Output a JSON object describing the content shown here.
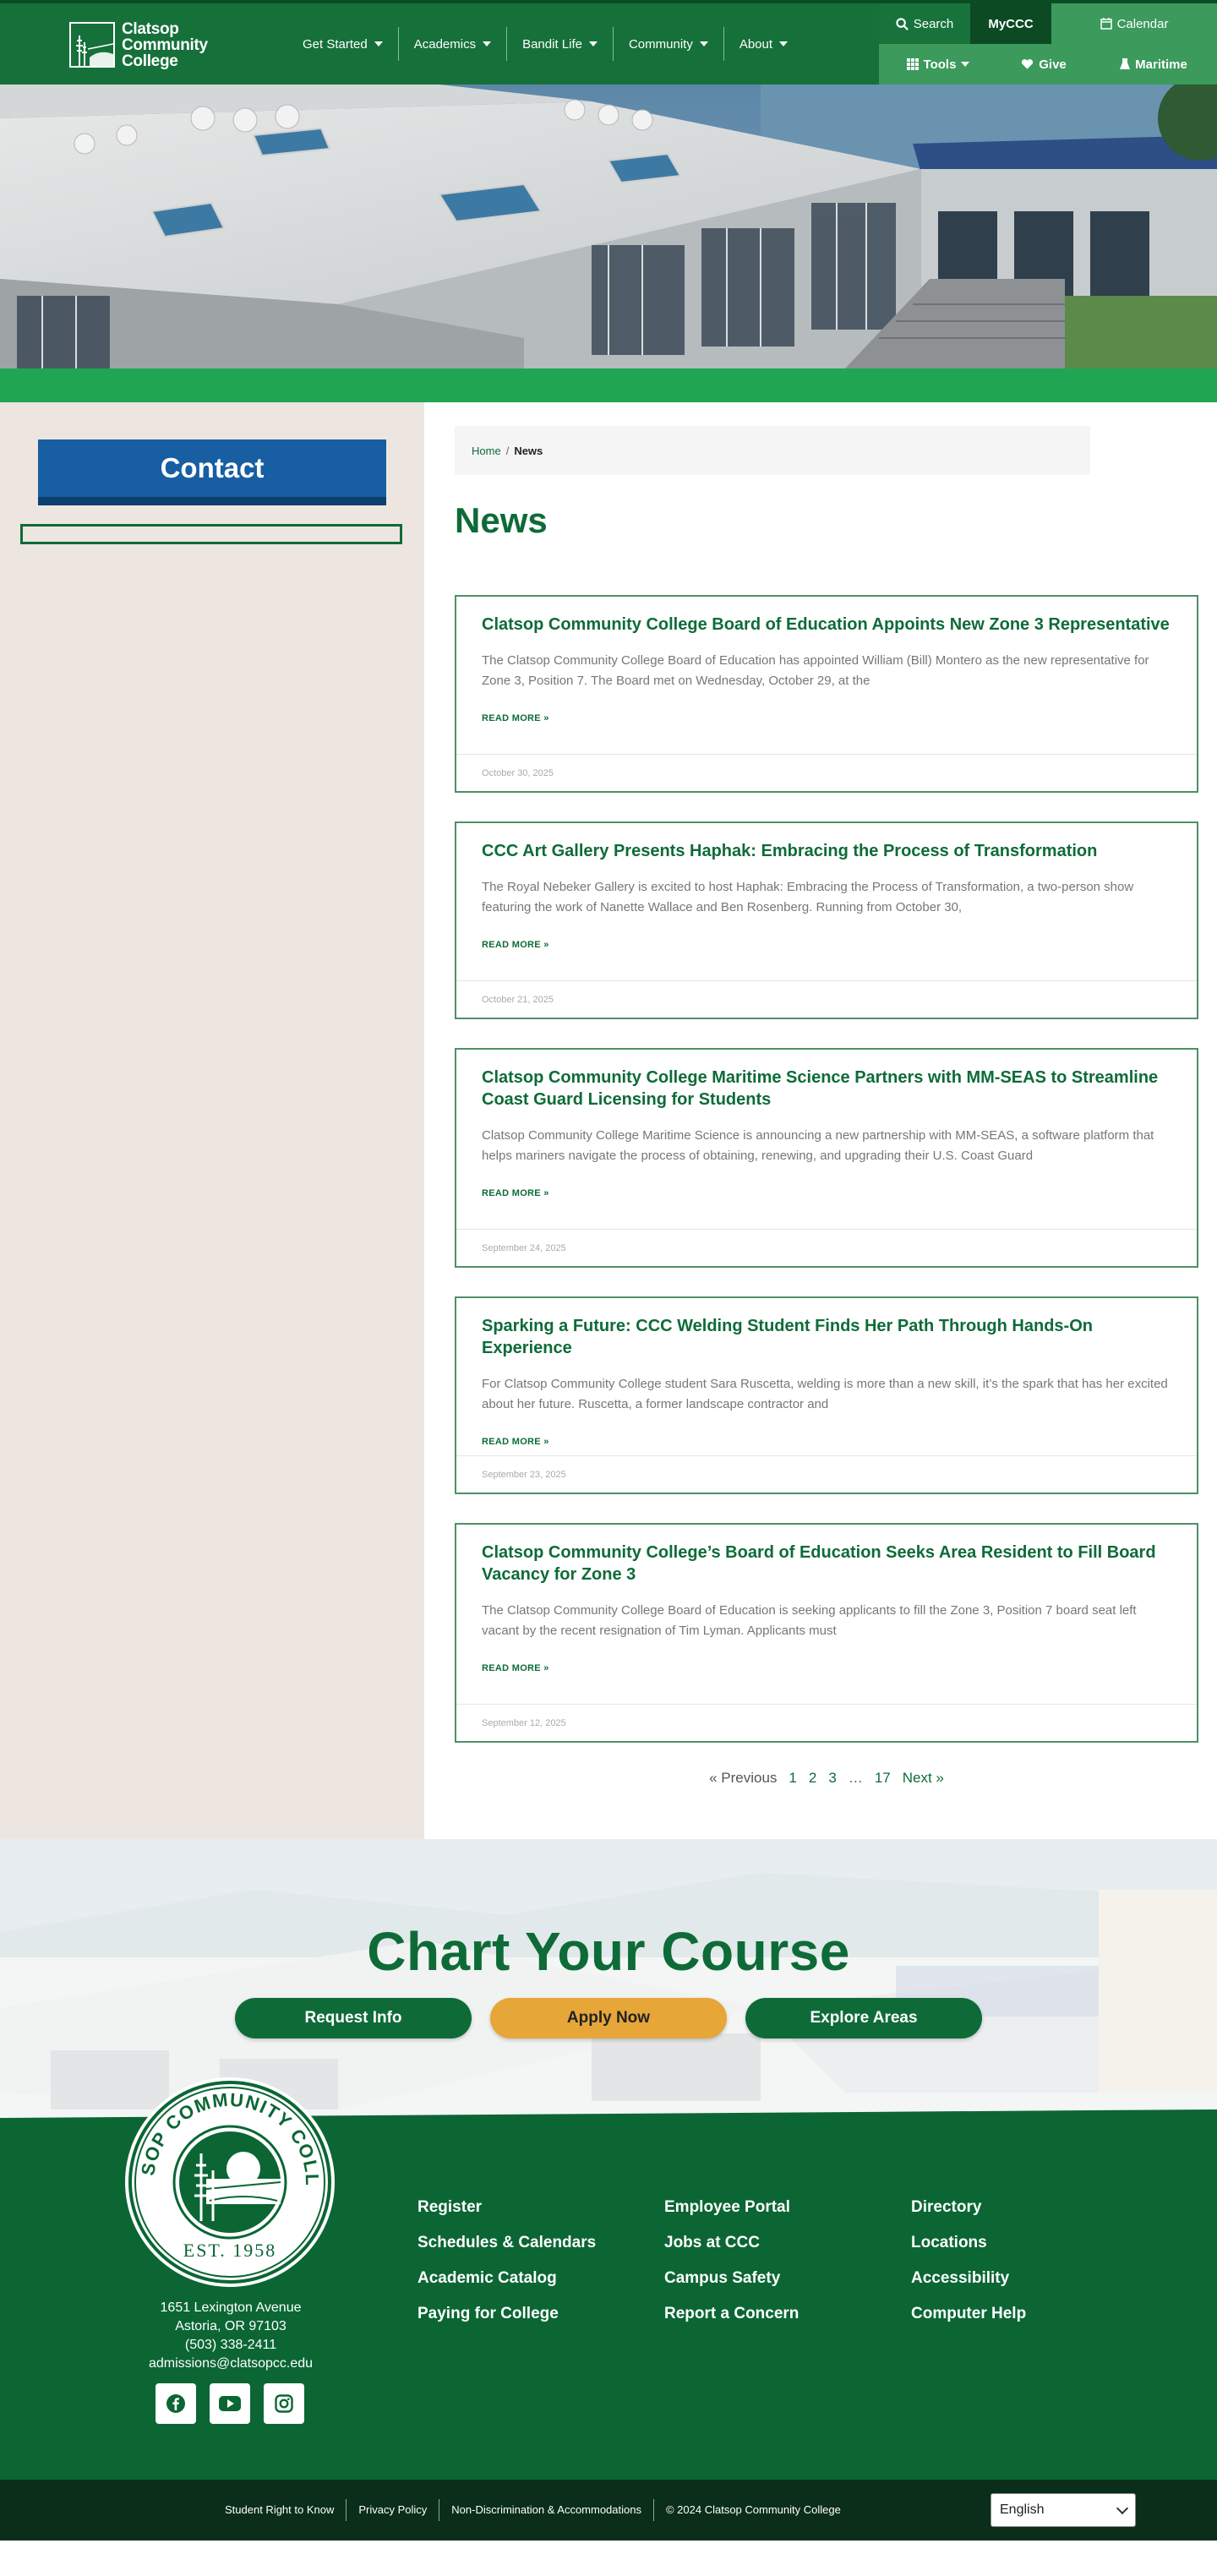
{
  "header": {
    "logo": {
      "line1": "Clatsop",
      "line2": "Community",
      "line3": "College"
    },
    "nav": [
      {
        "label": "Get Started"
      },
      {
        "label": "Academics"
      },
      {
        "label": "Bandit Life"
      },
      {
        "label": "Community"
      },
      {
        "label": "About"
      }
    ],
    "utility": {
      "search": "Search",
      "myccc": "MyCCC",
      "calendar": "Calendar",
      "tools": "Tools",
      "give": "Give",
      "maritime": "Maritime"
    }
  },
  "sidebar": {
    "contact_label": "Contact"
  },
  "breadcrumb": {
    "home": "Home",
    "separator": "/",
    "current": "News"
  },
  "page_title": "News",
  "articles": [
    {
      "title": "Clatsop Community College Board of Education Appoints New Zone 3 Representative",
      "excerpt": "The Clatsop Community College Board of Education has appointed William (Bill) Montero as the new representative for Zone 3, Position 7. The Board met on Wednesday, October 29, at the",
      "more": "READ MORE »",
      "date": "October 30, 2025"
    },
    {
      "title": "CCC Art Gallery Presents Haphak: Embracing the Process of Transformation",
      "excerpt": "The Royal Nebeker Gallery is excited to host Haphak: Embracing the Process of Transformation, a two-person show featuring the work of Nanette Wallace and Ben Rosenberg. Running from October 30,",
      "more": "READ MORE »",
      "date": "October 21, 2025"
    },
    {
      "title": "Clatsop Community College Maritime Science Partners with MM-SEAS to Streamline Coast Guard Licensing for Students",
      "excerpt": "Clatsop Community College Maritime Science is announcing a new partnership with MM-SEAS, a software platform that helps mariners navigate the process of obtaining, renewing, and upgrading their U.S. Coast Guard",
      "more": "READ MORE »",
      "date": "September 24, 2025"
    },
    {
      "title": "Sparking a Future: CCC Welding Student Finds Her Path Through Hands-On Experience",
      "excerpt": "For Clatsop Community College student Sara Ruscetta, welding is more than a new skill, it’s the spark that has her excited about her future. Ruscetta, a former landscape contractor and",
      "more": "READ MORE »",
      "date": "September 23, 2025"
    },
    {
      "title": "Clatsop Community College’s Board of Education Seeks Area Resident to Fill Board Vacancy for Zone 3",
      "excerpt": "The Clatsop Community College Board of Education is seeking applicants to fill the Zone 3, Position 7 board seat left vacant by the recent resignation of Tim Lyman.  Applicants must",
      "more": "READ MORE »",
      "date": "September 12, 2025"
    }
  ],
  "pagination": {
    "previous": "« Previous",
    "pages": [
      "1",
      "2",
      "3"
    ],
    "ellipsis": "…",
    "last": "17",
    "next": "Next »"
  },
  "cta": {
    "title": "Chart Your Course",
    "buttons": [
      {
        "label": "Request Info"
      },
      {
        "label": "Apply Now"
      },
      {
        "label": "Explore Areas"
      }
    ]
  },
  "footer": {
    "seal_text": "CLATSOP COMMUNITY COLLEGE",
    "seal_est": "EST. 1958",
    "address": [
      "1651 Lexington Avenue",
      "Astoria, OR 97103",
      "(503) 338-2411",
      "admissions@clatsopcc.edu"
    ],
    "social_icons": [
      "facebook-icon",
      "youtube-icon",
      "instagram-icon"
    ],
    "col1": [
      "Register",
      "Schedules & Calendars",
      "Academic Catalog",
      "Paying for College"
    ],
    "col2": [
      "Employee Portal",
      "Jobs at CCC",
      "Campus Safety",
      "Report a Concern"
    ],
    "col3": [
      "Directory",
      "Locations",
      "Accessibility",
      "Computer Help"
    ]
  },
  "bottom_bar": {
    "links": [
      "Student Right to Know",
      "Privacy Policy",
      "Non-Discrimination & Accommodations",
      "© 2024 Clatsop Community College"
    ],
    "language": "English"
  },
  "colors": {
    "brand_green": "#0e6b38",
    "header_green": "#17733b",
    "contact_blue": "#175ea3",
    "apply_gold": "#e6a638",
    "sidebar_bg": "#ede6e0"
  }
}
